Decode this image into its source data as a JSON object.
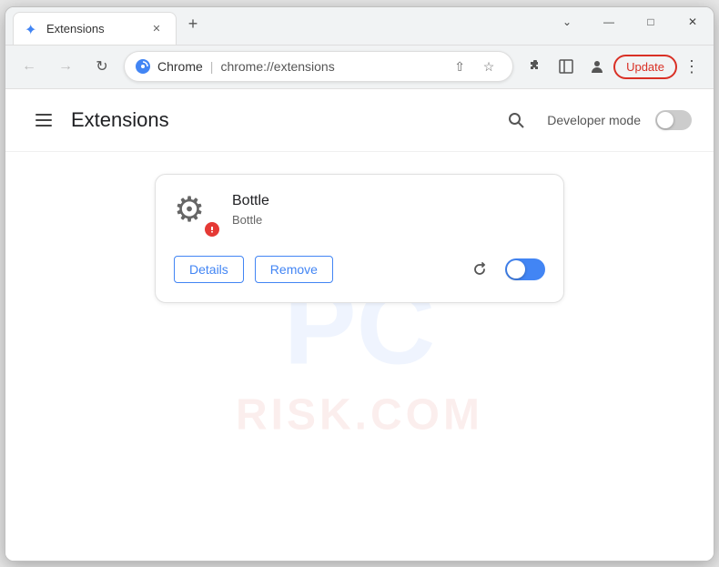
{
  "browser": {
    "tab_title": "Extensions",
    "tab_favicon": "✦",
    "url_chrome_text": "Chrome",
    "url_full": "chrome://extensions",
    "update_button_label": "Update",
    "new_tab_icon": "+",
    "close_icon": "✕",
    "minimize_icon": "—",
    "maximize_icon": "□",
    "winctrl_close": "✕"
  },
  "page": {
    "title": "Extensions",
    "hamburger_label": "Menu",
    "search_label": "Search extensions",
    "developer_mode_label": "Developer mode",
    "developer_mode_state": "off"
  },
  "extension": {
    "name": "Bottle",
    "description": "Bottle",
    "details_button": "Details",
    "remove_button": "Remove",
    "enabled": true
  },
  "watermark": {
    "line1": "PC",
    "line2": "RISK.COM"
  }
}
